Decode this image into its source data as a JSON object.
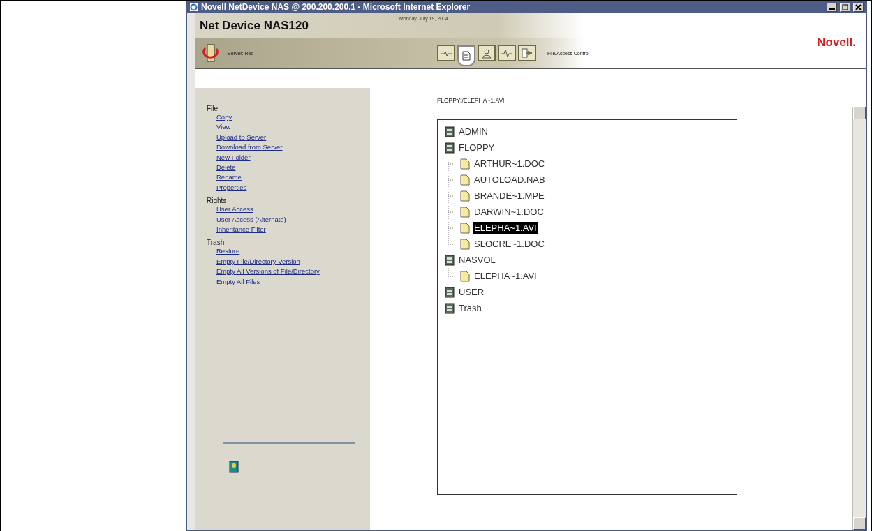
{
  "window": {
    "title": "Novell NetDevice NAS @ 200.200.200.1 - Microsoft Internet Explorer"
  },
  "header": {
    "product": "Net Device NAS120",
    "date": "Monday, July 19, 2004",
    "server": "Server: Red",
    "brand": "Novell.",
    "section": "File/Access Control",
    "tabs": [
      {
        "kind": "wave",
        "selected": false
      },
      {
        "kind": "file",
        "selected": true
      },
      {
        "kind": "user",
        "selected": false
      },
      {
        "kind": "pulse",
        "selected": false
      },
      {
        "kind": "exit",
        "selected": false
      }
    ]
  },
  "sidebar": {
    "groups": [
      {
        "title": "File",
        "links": [
          "Copy",
          "View",
          "Upload to Server",
          "Download from Server",
          "New Folder",
          "Delete",
          "Rename",
          "Properties"
        ]
      },
      {
        "title": "Rights",
        "links": [
          "User Access",
          "User Access (Alternate)",
          "Inheritance Filter"
        ]
      },
      {
        "title": "Trash",
        "links": [
          "Restore",
          "Empty File/Directory Version",
          "Empty All Versions of File/Directory",
          "Empty All Files"
        ]
      }
    ]
  },
  "path": "FLOPPY:/ELEPHA~1.AVI",
  "tree": [
    {
      "label": "ADMIN",
      "kind": "volume",
      "selected": false
    },
    {
      "label": "FLOPPY",
      "kind": "volume",
      "selected": false,
      "children": [
        {
          "label": "ARTHUR~1.DOC",
          "kind": "file",
          "selected": false
        },
        {
          "label": "AUTOLOAD.NAB",
          "kind": "file",
          "selected": false
        },
        {
          "label": "BRANDE~1.MPE",
          "kind": "file",
          "selected": false
        },
        {
          "label": "DARWIN~1.DOC",
          "kind": "file",
          "selected": false
        },
        {
          "label": "ELEPHA~1.AVI",
          "kind": "file",
          "selected": true
        },
        {
          "label": "SLOCRE~1.DOC",
          "kind": "file",
          "selected": false
        }
      ]
    },
    {
      "label": "NASVOL",
      "kind": "volume",
      "selected": false,
      "children": [
        {
          "label": "ELEPHA~1.AVI",
          "kind": "file",
          "selected": false
        }
      ]
    },
    {
      "label": "USER",
      "kind": "volume",
      "selected": false
    },
    {
      "label": "Trash",
      "kind": "volume",
      "selected": false
    }
  ]
}
